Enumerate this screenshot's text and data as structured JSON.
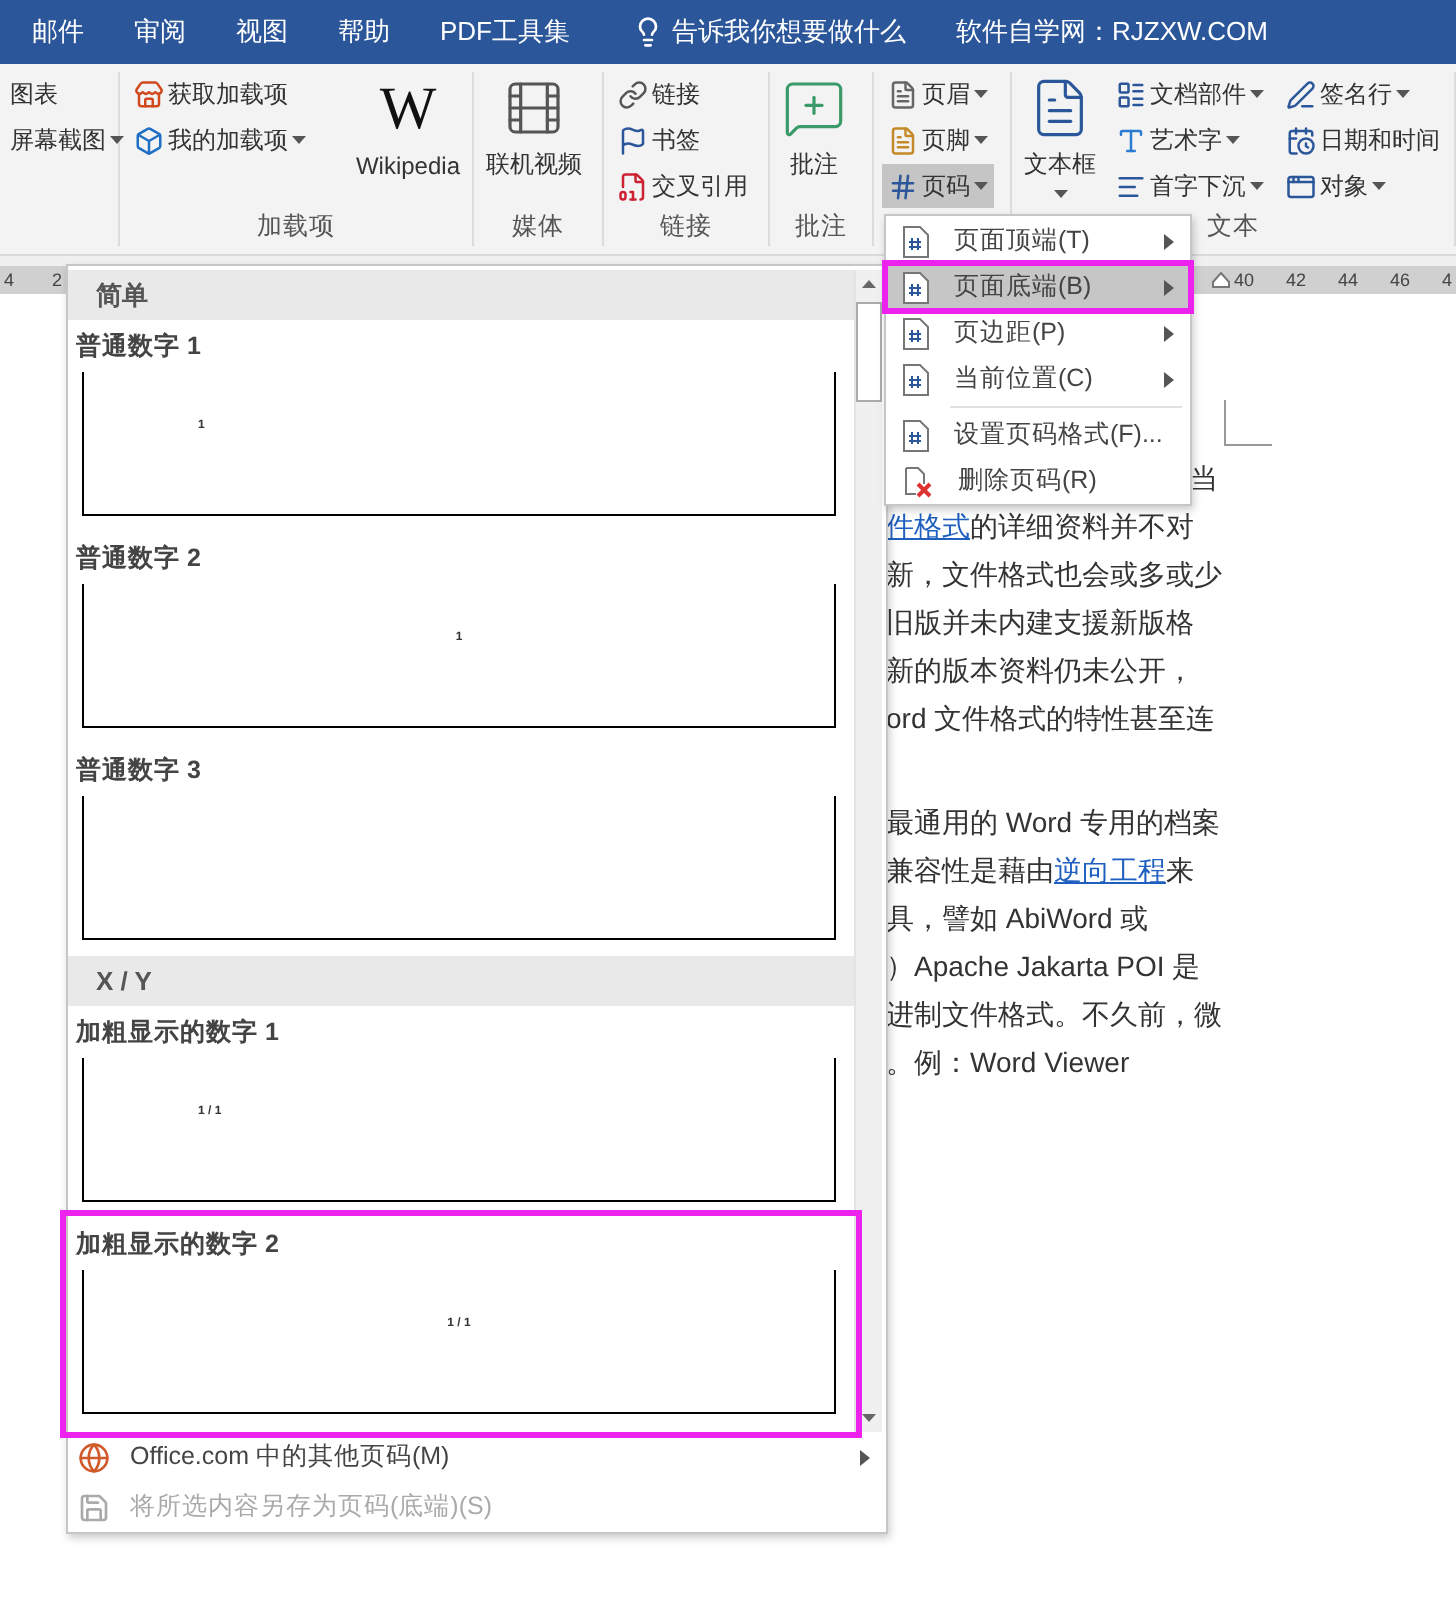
{
  "title_bar": {
    "tabs": [
      {
        "label": "邮件"
      },
      {
        "label": "审阅"
      },
      {
        "label": "视图"
      },
      {
        "label": "帮助"
      },
      {
        "label": "PDF工具集"
      }
    ],
    "tell_me": "告诉我你想要做什么",
    "site": "软件自学网：RJZXW.COM"
  },
  "ribbon": {
    "groups": [
      {
        "items": [
          {
            "label": "图表",
            "kind": "small",
            "dropdown": false,
            "selected": false
          },
          {
            "label": "屏幕截图",
            "kind": "small",
            "dropdown": true,
            "selected": false
          }
        ]
      },
      {
        "label": "加载项",
        "items": [
          {
            "label": "获取加载项",
            "kind": "small",
            "dropdown": false,
            "selected": false
          },
          {
            "label": "我的加载项",
            "kind": "small",
            "dropdown": true,
            "selected": false
          },
          {
            "label": "Wikipedia",
            "kind": "logo",
            "logo": "W",
            "dropdown": false,
            "selected": false
          }
        ]
      },
      {
        "label": "媒体",
        "items": [
          {
            "label": "联机视频",
            "kind": "large",
            "dropdown": false,
            "selected": false
          }
        ]
      },
      {
        "label": "链接",
        "items": [
          {
            "label": "链接",
            "kind": "small",
            "dropdown": false,
            "selected": false
          },
          {
            "label": "书签",
            "kind": "small",
            "dropdown": false,
            "selected": false
          },
          {
            "label": "交叉引用",
            "kind": "small",
            "dropdown": false,
            "selected": false
          }
        ]
      },
      {
        "label": "批注",
        "items": [
          {
            "label": "批注",
            "kind": "large",
            "dropdown": false,
            "selected": false
          }
        ]
      },
      {
        "items": [
          {
            "label": "页眉",
            "kind": "small",
            "dropdown": true,
            "selected": false
          },
          {
            "label": "页脚",
            "kind": "small",
            "dropdown": true,
            "selected": false
          },
          {
            "label": "页码",
            "kind": "small",
            "dropdown": true,
            "selected": true
          }
        ]
      },
      {
        "label": "文本",
        "items": [
          {
            "label": "文本框",
            "kind": "large",
            "dropdown": true,
            "selected": false
          },
          {
            "label": "文档部件",
            "kind": "small",
            "dropdown": true,
            "selected": false
          },
          {
            "label": "艺术字",
            "kind": "small",
            "dropdown": true,
            "selected": false
          },
          {
            "label": "首字下沉",
            "kind": "small",
            "dropdown": true,
            "selected": false
          },
          {
            "label": "签名行",
            "kind": "small",
            "dropdown": true,
            "selected": false
          },
          {
            "label": "日期和时间",
            "kind": "small",
            "dropdown": false,
            "selected": false
          },
          {
            "label": "对象",
            "kind": "small",
            "dropdown": true,
            "selected": false
          }
        ]
      }
    ]
  },
  "ruler": {
    "left_ticks": [
      "4",
      "2"
    ],
    "right_ticks": [
      "40",
      "42",
      "44",
      "46",
      "4"
    ]
  },
  "document": {
    "paragraphs": [
      [
        [
          {
            "text": "当",
            "link": false
          }
        ],
        [
          {
            "text": "件格式",
            "link": true
          },
          {
            "text": "的详细资料并不对",
            "link": false
          }
        ],
        [
          {
            "text": "新，文件格式也会或多或少",
            "link": false
          }
        ],
        [
          {
            "text": "旧版并未内建支援新版格",
            "link": false
          }
        ],
        [
          {
            "text": "新的版本资料仍未公开，",
            "link": false
          }
        ],
        [
          {
            "text": "ord 文件格式的特性甚至连",
            "link": false
          }
        ]
      ],
      [
        [
          {
            "text": "最通用的 Word 专用的档案",
            "link": false
          }
        ],
        [
          {
            "text": "兼容性是藉由",
            "link": false
          },
          {
            "text": "逆向工程",
            "link": true
          },
          {
            "text": "来",
            "link": false
          }
        ],
        [
          {
            "text": "具，譬如 AbiWord 或",
            "link": false
          }
        ],
        [
          {
            "text": "）Apache Jakarta POI 是",
            "link": false
          }
        ],
        [
          {
            "text": "进制文件格式。不久前，微",
            "link": false
          }
        ],
        [
          {
            "text": "。例：Word Viewer",
            "link": false
          }
        ]
      ]
    ]
  },
  "gallery": {
    "sections": [
      {
        "title": "简单",
        "items": [
          {
            "label": "普通数字 1",
            "highlighted": false,
            "preview": {
              "number": "1",
              "kind": "left"
            }
          },
          {
            "label": "普通数字 2",
            "highlighted": false,
            "preview": {
              "number": "1",
              "kind": "center"
            }
          },
          {
            "label": "普通数字 3",
            "highlighted": false
          }
        ]
      },
      {
        "title": "X / Y",
        "items": [
          {
            "label": "加粗显示的数字 1",
            "highlighted": false,
            "preview": {
              "number": "1 / 1",
              "kind": "left"
            }
          },
          {
            "label": "加粗显示的数字 2",
            "highlighted": true,
            "preview": {
              "number": "1 / 1",
              "kind": "center"
            }
          }
        ]
      }
    ],
    "footer": [
      {
        "label": "Office.com 中的其他页码(M)",
        "disabled": false,
        "submenu": true
      },
      {
        "label": "将所选内容另存为页码(底端)(S)",
        "disabled": true,
        "submenu": false
      }
    ]
  },
  "submenu": {
    "items": [
      {
        "kind": "submenu",
        "label": "页面顶端(T)",
        "selected": false,
        "highlighted": false
      },
      {
        "kind": "submenu",
        "label": "页面底端(B)",
        "selected": true,
        "highlighted": true
      },
      {
        "kind": "submenu",
        "label": "页边距(P)",
        "selected": false,
        "highlighted": false
      },
      {
        "kind": "submenu",
        "label": "当前位置(C)",
        "selected": false,
        "highlighted": false
      },
      {
        "kind": "separator"
      },
      {
        "kind": "command",
        "label": "设置页码格式(F)...",
        "selected": false,
        "highlighted": false
      },
      {
        "kind": "command",
        "label": "删除页码(R)",
        "selected": false,
        "highlighted": false
      }
    ]
  }
}
